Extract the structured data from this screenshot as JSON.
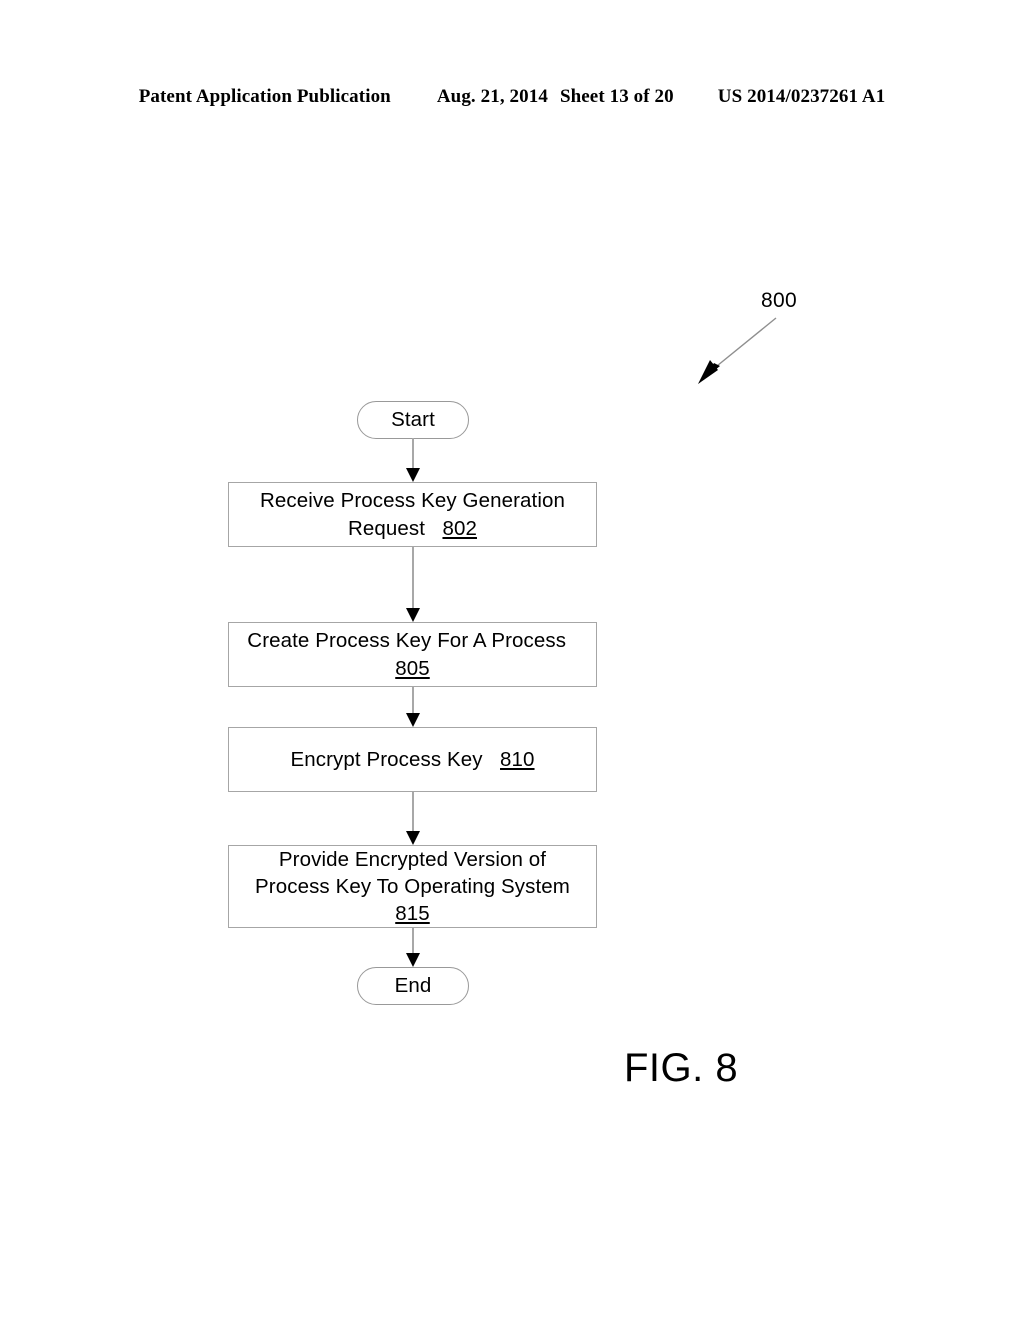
{
  "header": {
    "publication": "Patent Application Publication",
    "date": "Aug. 21, 2014",
    "sheet": "Sheet 13 of 20",
    "patent_number": "US 2014/0237261 A1"
  },
  "figure": {
    "reference_label": "800",
    "caption": "FIG. 8"
  },
  "flowchart": {
    "nodes": [
      {
        "id": "start",
        "type": "terminal",
        "label": "Start"
      },
      {
        "id": "802",
        "type": "process",
        "text": "Receive Process Key Generation Request",
        "ref": "802"
      },
      {
        "id": "805",
        "type": "process",
        "text": "Create Process Key For A Process",
        "ref": "805"
      },
      {
        "id": "810",
        "type": "process",
        "text": "Encrypt Process Key",
        "ref": "810"
      },
      {
        "id": "815",
        "type": "process",
        "text": "Provide Encrypted Version of Process Key To Operating System",
        "ref": "815"
      },
      {
        "id": "end",
        "type": "terminal",
        "label": "End"
      }
    ]
  },
  "colors": {
    "node_border": "#a6a6a6",
    "connector_line": "#a8a8a8",
    "arrow_head": "#000000",
    "text": "#000000",
    "background": "#ffffff"
  }
}
